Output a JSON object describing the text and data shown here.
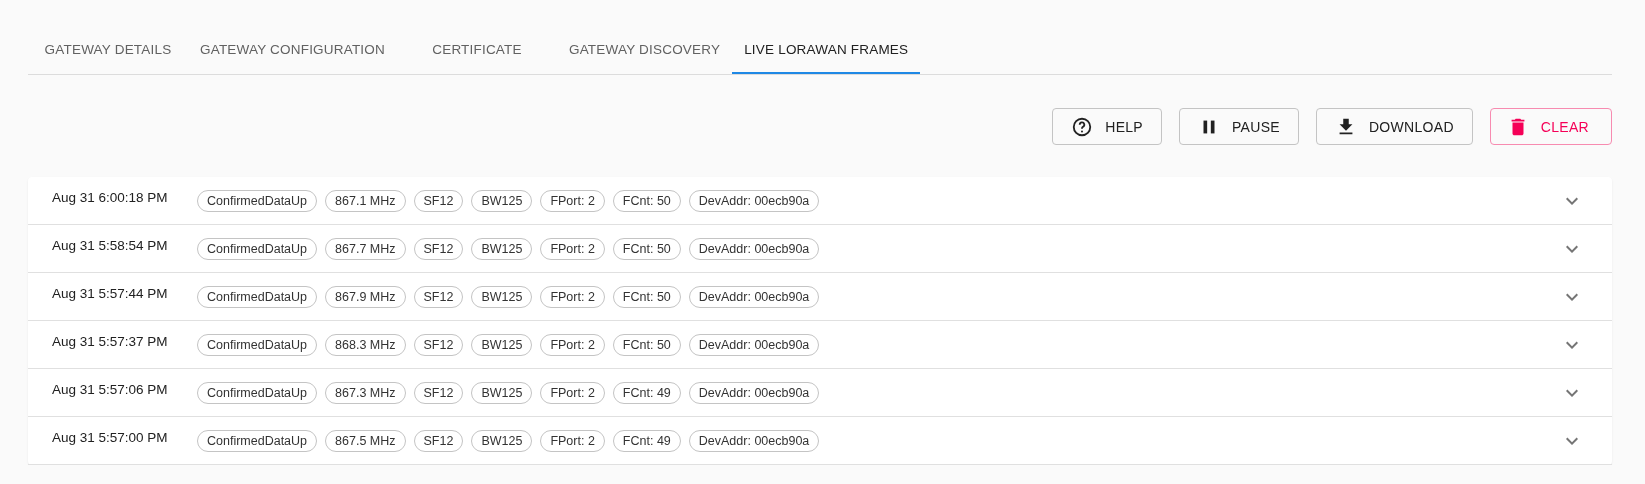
{
  "tabs": [
    {
      "label": "GATEWAY DETAILS",
      "selected": false
    },
    {
      "label": "GATEWAY CONFIGURATION",
      "selected": false
    },
    {
      "label": "CERTIFICATE",
      "selected": false
    },
    {
      "label": "GATEWAY DISCOVERY",
      "selected": false
    },
    {
      "label": "LIVE LORAWAN FRAMES",
      "selected": true
    }
  ],
  "toolbar": [
    {
      "kind": "help",
      "label": "HELP"
    },
    {
      "kind": "pause",
      "label": "PAUSE"
    },
    {
      "kind": "download",
      "label": "DOWNLOAD"
    },
    {
      "kind": "clear",
      "label": "CLEAR"
    }
  ],
  "frames": [
    {
      "time": "Aug 31 6:00:18 PM",
      "chips": [
        "ConfirmedDataUp",
        "867.1 MHz",
        "SF12",
        "BW125",
        "FPort: 2",
        "FCnt: 50",
        "DevAddr: 00ecb90a"
      ]
    },
    {
      "time": "Aug 31 5:58:54 PM",
      "chips": [
        "ConfirmedDataUp",
        "867.7 MHz",
        "SF12",
        "BW125",
        "FPort: 2",
        "FCnt: 50",
        "DevAddr: 00ecb90a"
      ]
    },
    {
      "time": "Aug 31 5:57:44 PM",
      "chips": [
        "ConfirmedDataUp",
        "867.9 MHz",
        "SF12",
        "BW125",
        "FPort: 2",
        "FCnt: 50",
        "DevAddr: 00ecb90a"
      ]
    },
    {
      "time": "Aug 31 5:57:37 PM",
      "chips": [
        "ConfirmedDataUp",
        "868.3 MHz",
        "SF12",
        "BW125",
        "FPort: 2",
        "FCnt: 50",
        "DevAddr: 00ecb90a"
      ]
    },
    {
      "time": "Aug 31 5:57:06 PM",
      "chips": [
        "ConfirmedDataUp",
        "867.3 MHz",
        "SF12",
        "BW125",
        "FPort: 2",
        "FCnt: 49",
        "DevAddr: 00ecb90a"
      ]
    },
    {
      "time": "Aug 31 5:57:00 PM",
      "chips": [
        "ConfirmedDataUp",
        "867.5 MHz",
        "SF12",
        "BW125",
        "FPort: 2",
        "FCnt: 49",
        "DevAddr: 00ecb90a"
      ]
    }
  ]
}
